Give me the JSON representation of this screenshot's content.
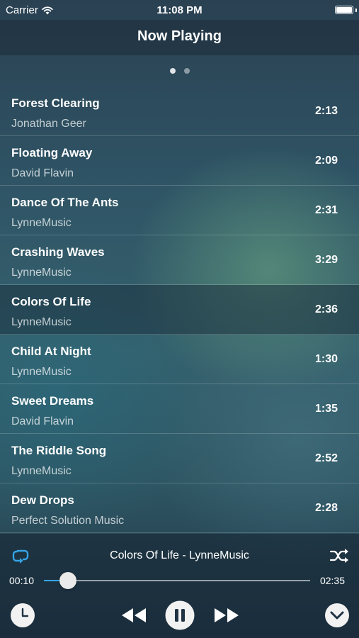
{
  "status": {
    "carrier": "Carrier",
    "time": "11:08 PM"
  },
  "nav": {
    "title": "Now Playing"
  },
  "pager": {
    "pages": 2,
    "current": 1
  },
  "tracks": [
    {
      "title": "Forest Clearing",
      "artist": "Jonathan Geer",
      "duration": "2:13"
    },
    {
      "title": "Floating Away",
      "artist": "David Flavin",
      "duration": "2:09"
    },
    {
      "title": "Dance Of The Ants",
      "artist": "LynneMusic",
      "duration": "2:31"
    },
    {
      "title": "Crashing Waves",
      "artist": "LynneMusic",
      "duration": "3:29"
    },
    {
      "title": "Colors Of Life",
      "artist": "LynneMusic",
      "duration": "2:36"
    },
    {
      "title": "Child At Night",
      "artist": "LynneMusic",
      "duration": "1:30"
    },
    {
      "title": "Sweet Dreams",
      "artist": "David Flavin",
      "duration": "1:35"
    },
    {
      "title": "The Riddle Song",
      "artist": "LynneMusic",
      "duration": "2:52"
    },
    {
      "title": "Dew Drops",
      "artist": "Perfect Solution Music",
      "duration": "2:28"
    }
  ],
  "selected_track_index": 4,
  "player": {
    "now_playing": "Colors Of Life - LynneMusic",
    "elapsed": "00:10",
    "total": "02:35",
    "progress": 0.09,
    "state": "playing",
    "accent_color": "#35a4e6",
    "icons": {
      "repeat": "repeat-icon",
      "shuffle": "shuffle-icon",
      "timer": "clock-icon",
      "rewind": "rewind-icon",
      "pause": "pause-icon",
      "fast_forward": "fast-forward-icon",
      "collapse": "chevron-down-icon"
    }
  }
}
